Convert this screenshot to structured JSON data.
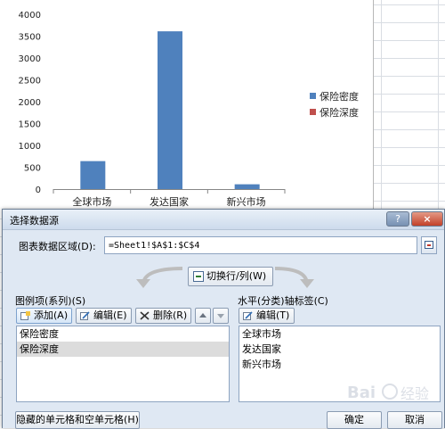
{
  "chart_data": {
    "type": "bar",
    "categories": [
      "全球市场",
      "发达国家",
      "新兴市场"
    ],
    "series": [
      {
        "name": "保险密度",
        "values": [
          640,
          3610,
          110
        ],
        "color": "#4f81bd"
      },
      {
        "name": "保险深度",
        "values": [
          0,
          0,
          0
        ],
        "color": "#c0504d"
      }
    ],
    "yticks": [
      0,
      500,
      1000,
      1500,
      2000,
      2500,
      3000,
      3500,
      4000
    ],
    "ylim": [
      0,
      4000
    ],
    "legend": "right",
    "grid": false
  },
  "dialog": {
    "title": "选择数据源",
    "help": "?",
    "close": "×",
    "range_label": "图表数据区域(D):",
    "range_value": "=Sheet1!$A$1:$C$4",
    "switch_label": "切换行/列(W)",
    "series_section": "图例项(系列)(S)",
    "axis_section": "水平(分类)轴标签(C)",
    "add_label": "添加(A)",
    "edit_label": "编辑(E)",
    "remove_label": "删除(R)",
    "axis_edit_label": "编辑(T)",
    "series_items": [
      "保险密度",
      "保险深度"
    ],
    "axis_items": [
      "全球市场",
      "发达国家",
      "新兴市场"
    ],
    "hidden_cells_label": "隐藏的单元格和空单元格(H)",
    "ok_label": "确定",
    "cancel_label": "取消"
  },
  "watermark_text": "Bai 经验"
}
